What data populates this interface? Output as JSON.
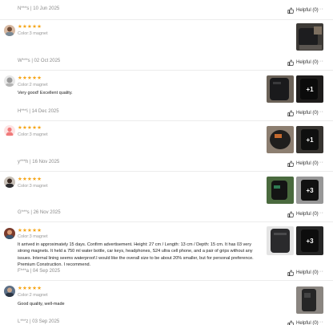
{
  "helpful_label": "Helpful (0)",
  "more_label": "···",
  "colors": {
    "star": "#f6a416",
    "meta": "#8a8a8a"
  },
  "reviews": [
    {
      "meta": "N***s | 10 Jun 2025"
    },
    {
      "stars": "★★★★★",
      "variant": "Color:3 magnet",
      "body": "",
      "meta": "W***s | 02 Oct 2025",
      "more_photos": ""
    },
    {
      "stars": "★★★★★",
      "variant": "Color:2 magnet",
      "body": "Very good! Excellent quality.",
      "meta": "H***i | 14 Dec 2025",
      "more_photos": "+1"
    },
    {
      "stars": "★★★★★",
      "variant": "Color:3 magnet",
      "body": "",
      "meta": "y***h | 16 Nov 2025",
      "more_photos": "+1"
    },
    {
      "stars": "★★★★★",
      "variant": "Color:3 magnet",
      "body": "",
      "meta": "G***s | 26 Nov 2025",
      "more_photos": "+3"
    },
    {
      "stars": "★★★★★",
      "variant": "Color:3 magnet",
      "body": "It arrived in approximately 15 days. Confirm advertisement. Height: 27 cm / Length: 13 cm / Depth: 15 cm. It has 03 very strong magnets. It held a 750 ml water bottle, car keys, headphones, S24 ultra cell phone, and a pair of grips without any issues. Internal lining seems waterproof.I would like the overall size to be about 20% smaller, but for personal preference. Premium Construction. I recommend.",
      "meta": "F***a | 04 Sep 2025",
      "more_photos": "+3"
    },
    {
      "stars": "★★★★★",
      "variant": "Color:2 magnet",
      "body": "Good quality, well-made",
      "meta": "L***z | 03 Sep 2025",
      "more_photos": ""
    }
  ]
}
